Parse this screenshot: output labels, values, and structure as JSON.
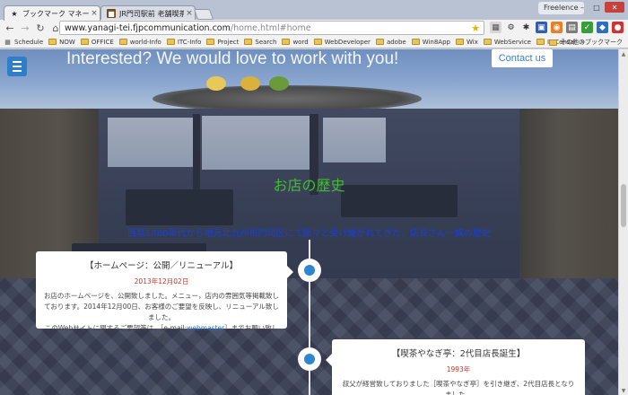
{
  "browser": {
    "tabs": [
      {
        "title": "ブックマーク マネージャ",
        "icon": "star-icon",
        "active": true
      },
      {
        "title": "JR門司駅前 老舗喫茶やな",
        "icon": "cafe-favicon",
        "active": false
      }
    ],
    "profile": "Freelence",
    "url_host": "www.yanagi-tei.fjpcommunication.com",
    "url_path": "/home.html#home"
  },
  "bookmarks": {
    "items": [
      {
        "label": "Schedule",
        "type": "link"
      },
      {
        "label": "NOW",
        "type": "folder"
      },
      {
        "label": "OFFICE",
        "type": "folder"
      },
      {
        "label": "world-Info",
        "type": "folder"
      },
      {
        "label": "ITC-Info",
        "type": "folder"
      },
      {
        "label": "Project",
        "type": "folder"
      },
      {
        "label": "Search",
        "type": "folder"
      },
      {
        "label": "word",
        "type": "folder"
      },
      {
        "label": "WebDeveloper",
        "type": "folder"
      },
      {
        "label": "adobe",
        "type": "folder"
      },
      {
        "label": "Win8App",
        "type": "folder"
      },
      {
        "label": "Wix",
        "type": "folder"
      },
      {
        "label": "WebService",
        "type": "folder"
      },
      {
        "label": "IT-Consal",
        "type": "folder"
      }
    ],
    "overflow": "»",
    "other": "その他のブックマーク"
  },
  "hero": {
    "text": "Interested? We would love to work with you!",
    "contact_label": "Contact us"
  },
  "section": {
    "title": "お店の歴史",
    "subtitle": "西暦1880年代から地元北九州市門司区にて脈々と受け継がれてきた、店長さん一族の歴史"
  },
  "timeline": [
    {
      "title": "【ホームページ：公開／リニューアル】",
      "date": "2013年12月02日",
      "body_1": "お店のホームページを、公開致しました。メニュー，店内の雰囲気等掲載致しております。2014年12月00日、お客様のご要望を反映し、リニューアル致しました。",
      "body_2": "このWebサイトに関するご要望等は、［e-mail:",
      "link": "webmaster",
      "body_3": "］までお願い致します。"
    },
    {
      "title": "【喫茶やなぎ亭：2代目店長誕生】",
      "date": "1993年",
      "body_1": "叔父が経営致しておりました［喫茶やなぎ亭］を引き継ぎ、2代目店長となりました。",
      "body_2": "",
      "link": "",
      "body_3": ""
    }
  ],
  "colors": {
    "accent": "#2e86d1",
    "section_title": "#3fbf2e",
    "section_subtitle": "#1d3fd0",
    "date": "#c0392b"
  }
}
